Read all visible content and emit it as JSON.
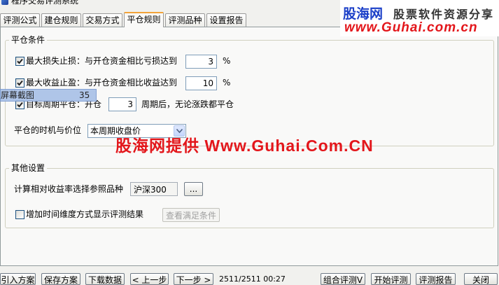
{
  "window": {
    "title": "程序交易评测系统",
    "icon": "app-icon"
  },
  "watermark": {
    "brand": "股海网",
    "slogan": "股票软件资源分享",
    "url": "www.Guhai.com.cn",
    "banner": "股海网提供 Www.Guhai.Com.CN"
  },
  "tabs": [
    {
      "label": "评测公式",
      "active": false
    },
    {
      "label": "建仓规则",
      "active": false
    },
    {
      "label": "交易方式",
      "active": false
    },
    {
      "label": "平仓规则",
      "active": true
    },
    {
      "label": "评测品种",
      "active": false
    },
    {
      "label": "设置报告",
      "active": false
    }
  ],
  "close_conditions": {
    "title": "平仓条件",
    "stop_loss": {
      "checked": true,
      "label": "最大损失止损：与开仓资金相比亏损达到",
      "value": "3",
      "unit": "%"
    },
    "take_profit": {
      "checked": true,
      "label": "最大收益止盈：与开仓资金相比收益达到",
      "value": "10",
      "unit": "%"
    },
    "period_close": {
      "checked": true,
      "label": "目标周期平仓：开仓",
      "value": "3",
      "suffix": "周期后，无论涨跌都平仓"
    },
    "timing": {
      "label": "平仓的时机与价位",
      "selected": "本周期收盘价"
    }
  },
  "capture_overlay": {
    "label": "屏幕截图",
    "value": "35"
  },
  "other_settings": {
    "title": "其他设置",
    "benchmark": {
      "label": "计算相对收益率选择参照品种",
      "value": "沪深300",
      "browse_label": "..."
    },
    "time_dimension": {
      "checked": false,
      "label": "增加时间维度方式显示评测结果",
      "view_button": "查看满足条件"
    }
  },
  "footer": {
    "import": "引入方案",
    "save": "保存方案",
    "download": "下载数据",
    "prev": "< 上一步",
    "next": "下一步 >",
    "status": "2511/2511 00:27",
    "combo": "组合评测V",
    "start": "开始评测",
    "report": "评测报告",
    "close": "关闭"
  },
  "colors": {
    "window_bg": "#f1f1ee",
    "page_bg": "#f9f9f8",
    "watermark_red": "#e3161b",
    "brand_blue": "#1b3fc8",
    "input_border": "#7f9db9",
    "active_tab_accent": "#f2a33a",
    "overlay_blue": "#a9c1e7",
    "dropdown_button": "#c3d5fd"
  }
}
